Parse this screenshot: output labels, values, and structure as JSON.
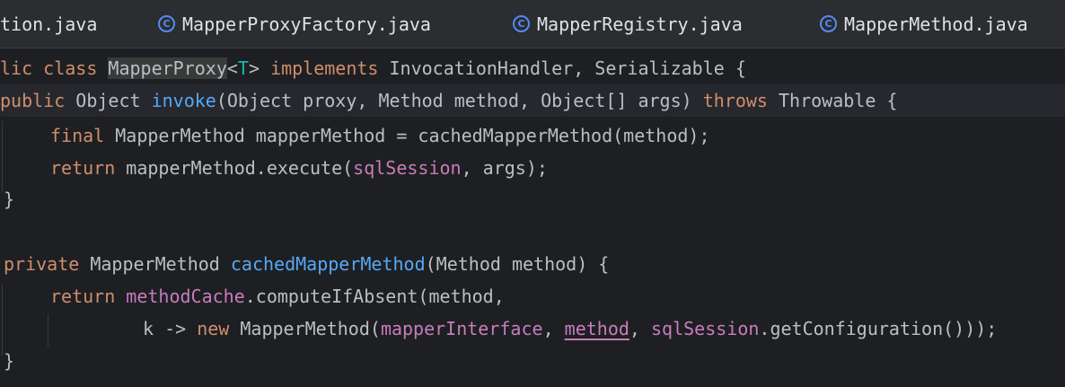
{
  "tabs": [
    {
      "label": "tion.java",
      "icon": "class-icon",
      "has_icon": false
    },
    {
      "label": "MapperProxyFactory.java",
      "icon": "class-icon",
      "has_icon": true
    },
    {
      "label": "MapperRegistry.java",
      "icon": "class-icon",
      "has_icon": true
    },
    {
      "label": "MapperMethod.java",
      "icon": "class-icon",
      "has_icon": true
    }
  ],
  "icon_glyph": "C",
  "code": {
    "l1": {
      "a": "lic ",
      "b": "class ",
      "c": "MapperProxy",
      "d": "<",
      "e": "T",
      "f": "> ",
      "g": "implements ",
      "h": "InvocationHandler, Serializable {"
    },
    "l2": {
      "a": "public ",
      "b": "Object ",
      "c": "invoke",
      "d": "(Object proxy, Method method, Object[] args) ",
      "e": "throws ",
      "f": "Throwable {"
    },
    "l3": {
      "a": "final ",
      "b": "MapperMethod mapperMethod = cachedMapperMethod(method);"
    },
    "l4": {
      "a": "return ",
      "b": "mapperMethod.execute(",
      "c": "sqlSession",
      "d": ", args);"
    },
    "l5": {
      "a": "}"
    },
    "l7": {
      "a": "private ",
      "b": "MapperMethod ",
      "c": "cachedMapperMethod",
      "d": "(Method method) {"
    },
    "l8": {
      "a": "return ",
      "b": "methodCache",
      "c": ".computeIfAbsent(method,"
    },
    "l9": {
      "a": "k -> ",
      "b": "new ",
      "c": "MapperMethod(",
      "d": "mapperInterface",
      "e": ", ",
      "f": "method",
      "g": ", ",
      "h": "sqlSession",
      "i": ".getConfiguration()));"
    },
    "l10": {
      "a": "}"
    }
  },
  "colors": {
    "keyword": "#cf8e6d",
    "function": "#56a8f5",
    "field": "#c77dbb",
    "type_param": "#16baac",
    "text": "#bcbec4",
    "icon": "#548af7"
  }
}
